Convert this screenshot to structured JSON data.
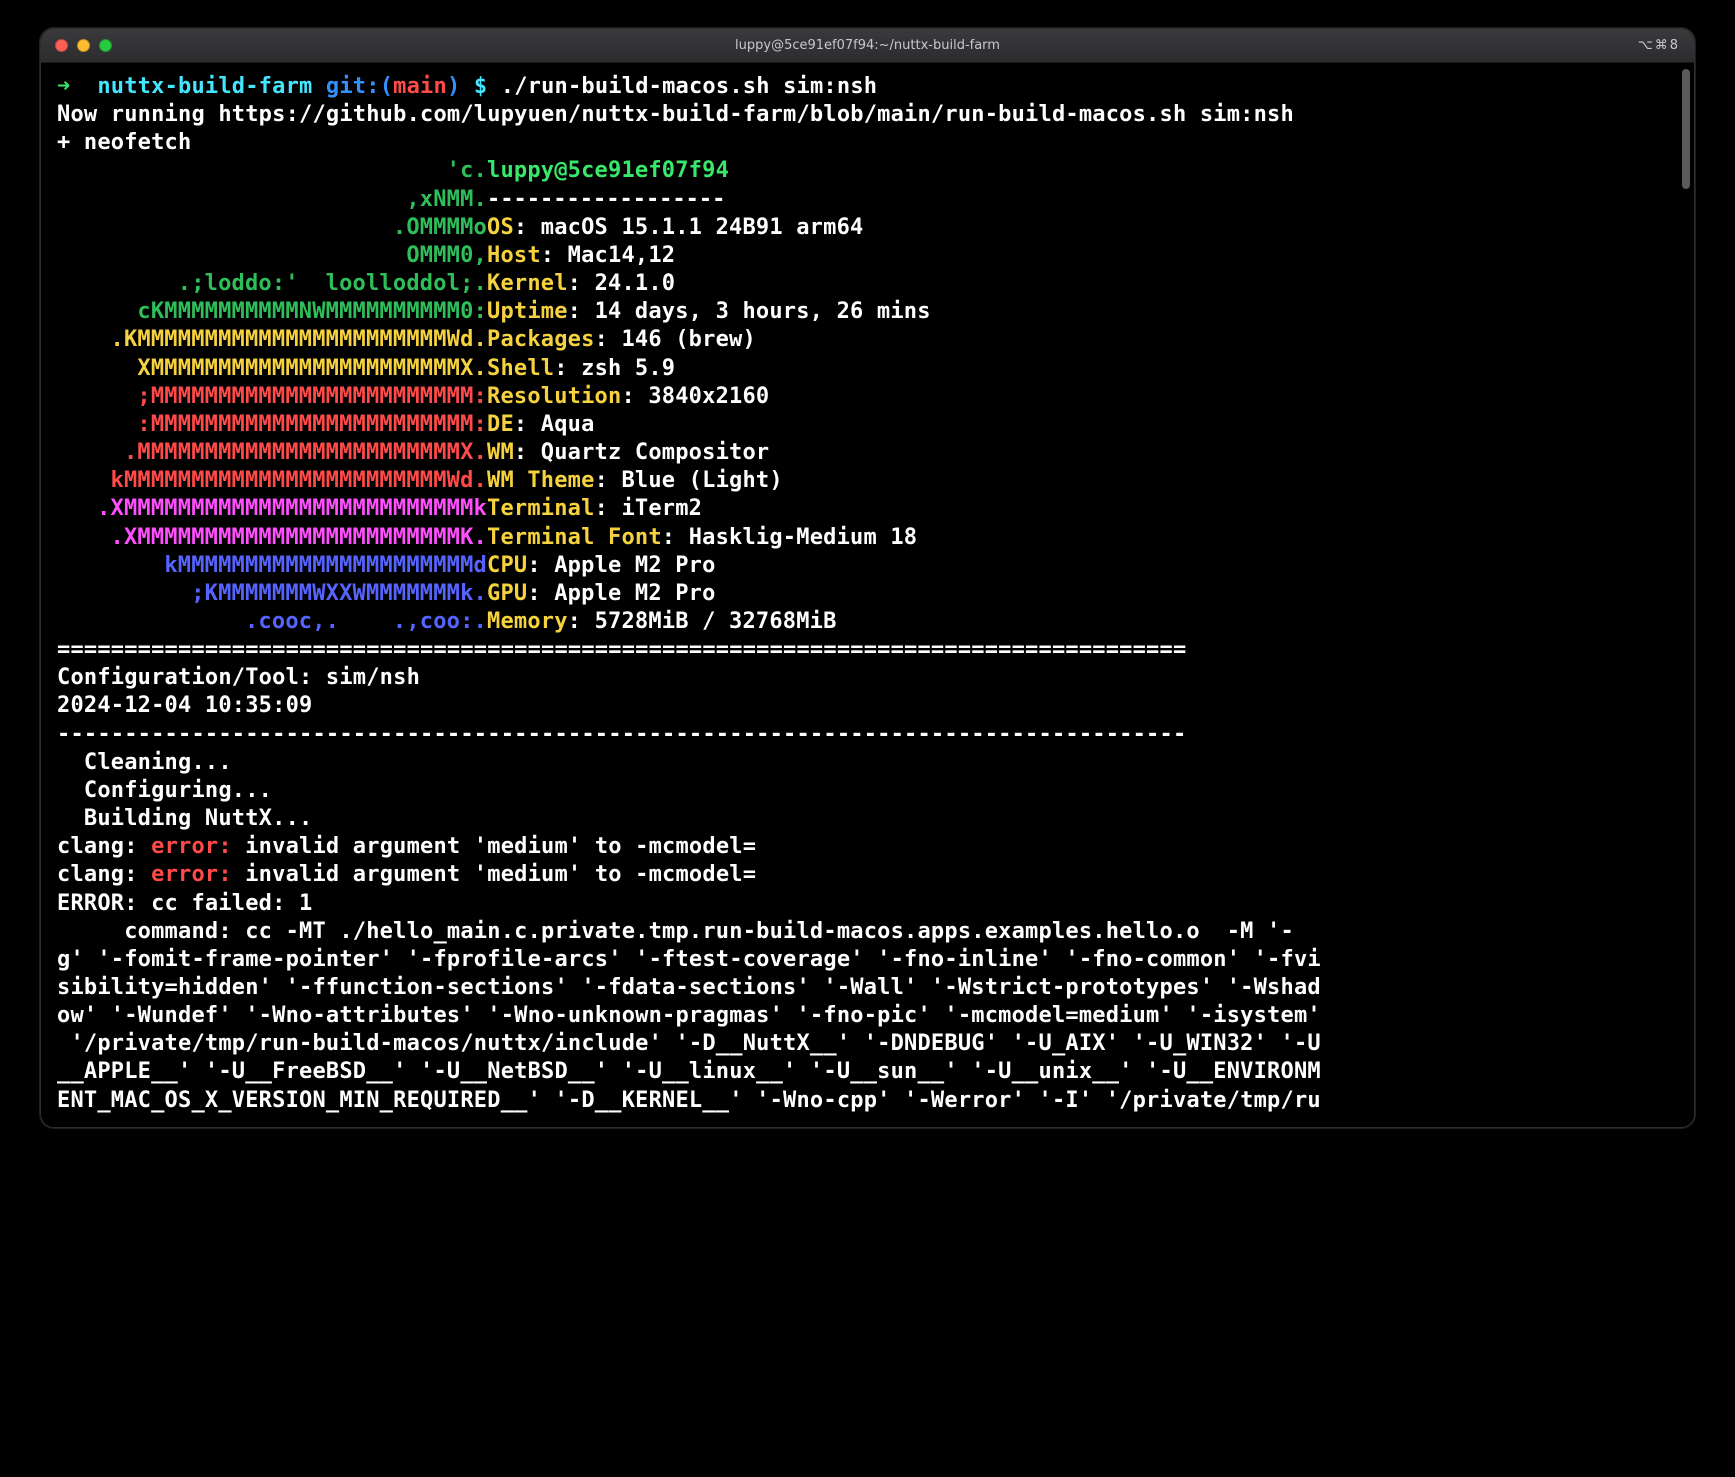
{
  "window": {
    "title": "luppy@5ce91ef07f94:~/nuttx-build-farm",
    "sysicons": "⌥⌘8"
  },
  "prompt": {
    "arrow": "➜",
    "dir": "nuttx-build-farm",
    "git_word": "git:(",
    "branch": "main",
    "git_close": ")",
    "dollar": "$",
    "cmd": "./run-build-macos.sh sim:nsh"
  },
  "run_line1": "Now running https://github.com/lupyuen/nuttx-build-farm/blob/main/run-build-macos.sh sim:nsh",
  "run_line2": "+ neofetch",
  "ascii": [
    "'c.",
    ",xNMM.",
    ".OMMMMo",
    "OMMM0,",
    ".;loddo:'  loolloddol;.",
    "cKMMMMMMMMMMNWMMMMMMMMMM0:",
    ".KMMMMMMMMMMMMMMMMMMMMMMMWd.",
    "XMMMMMMMMMMMMMMMMMMMMMMMX.",
    ";MMMMMMMMMMMMMMMMMMMMMMMM:",
    ":MMMMMMMMMMMMMMMMMMMMMMMM:",
    ".MMMMMMMMMMMMMMMMMMMMMMMMX.",
    "kMMMMMMMMMMMMMMMMMMMMMMMMWd.",
    ".XMMMMMMMMMMMMMMMMMMMMMMMMMMk",
    ".XMMMMMMMMMMMMMMMMMMMMMMMMK.",
    "kMMMMMMMMMMMMMMMMMMMMMMd",
    ";KMMMMMMMWXXWMMMMMMMk.",
    ".cooc,.    .,coo:."
  ],
  "nf": {
    "header": "luppy@5ce91ef07f94",
    "dashes": "------------------",
    "rows": [
      {
        "k": "OS",
        "v": "macOS 15.1.1 24B91 arm64"
      },
      {
        "k": "Host",
        "v": "Mac14,12"
      },
      {
        "k": "Kernel",
        "v": "24.1.0"
      },
      {
        "k": "Uptime",
        "v": "14 days, 3 hours, 26 mins"
      },
      {
        "k": "Packages",
        "v": "146 (brew)"
      },
      {
        "k": "Shell",
        "v": "zsh 5.9"
      },
      {
        "k": "Resolution",
        "v": "3840x2160"
      },
      {
        "k": "DE",
        "v": "Aqua"
      },
      {
        "k": "WM",
        "v": "Quartz Compositor"
      },
      {
        "k": "WM Theme",
        "v": "Blue (Light)"
      },
      {
        "k": "Terminal",
        "v": "iTerm2"
      },
      {
        "k": "Terminal Font",
        "v": "Hasklig-Medium 18"
      },
      {
        "k": "CPU",
        "v": "Apple M2 Pro"
      },
      {
        "k": "GPU",
        "v": "Apple M2 Pro"
      },
      {
        "k": "Memory",
        "v": "5728MiB / 32768MiB"
      }
    ]
  },
  "divider_eq": "====================================================================================",
  "config_line": "Configuration/Tool: sim/nsh",
  "timestamp": "2024-12-04 10:35:09",
  "divider_dash": "------------------------------------------------------------------------------------",
  "steps": {
    "clean": "  Cleaning...",
    "conf": "  Configuring...",
    "build": "  Building NuttX..."
  },
  "err": {
    "prefix": "clang: ",
    "word": "error:",
    "msg": " invalid argument 'medium' to -mcmodel="
  },
  "cc_error": "ERROR: cc failed: 1",
  "cc_cmd": "     command: cc -MT ./hello_main.c.private.tmp.run-build-macos.apps.examples.hello.o  -M '-\ng' '-fomit-frame-pointer' '-fprofile-arcs' '-ftest-coverage' '-fno-inline' '-fno-common' '-fvi\nsibility=hidden' '-ffunction-sections' '-fdata-sections' '-Wall' '-Wstrict-prototypes' '-Wshad\now' '-Wundef' '-Wno-attributes' '-Wno-unknown-pragmas' '-fno-pic' '-mcmodel=medium' '-isystem'\n '/private/tmp/run-build-macos/nuttx/include' '-D__NuttX__' '-DNDEBUG' '-U_AIX' '-U_WIN32' '-U\n__APPLE__' '-U__FreeBSD__' '-U__NetBSD__' '-U__linux__' '-U__sun__' '-U__unix__' '-U__ENVIRONM\nENT_MAC_OS_X_VERSION_MIN_REQUIRED__' '-D__KERNEL__' '-Wno-cpp' '-Werror' '-I' '/private/tmp/ru"
}
